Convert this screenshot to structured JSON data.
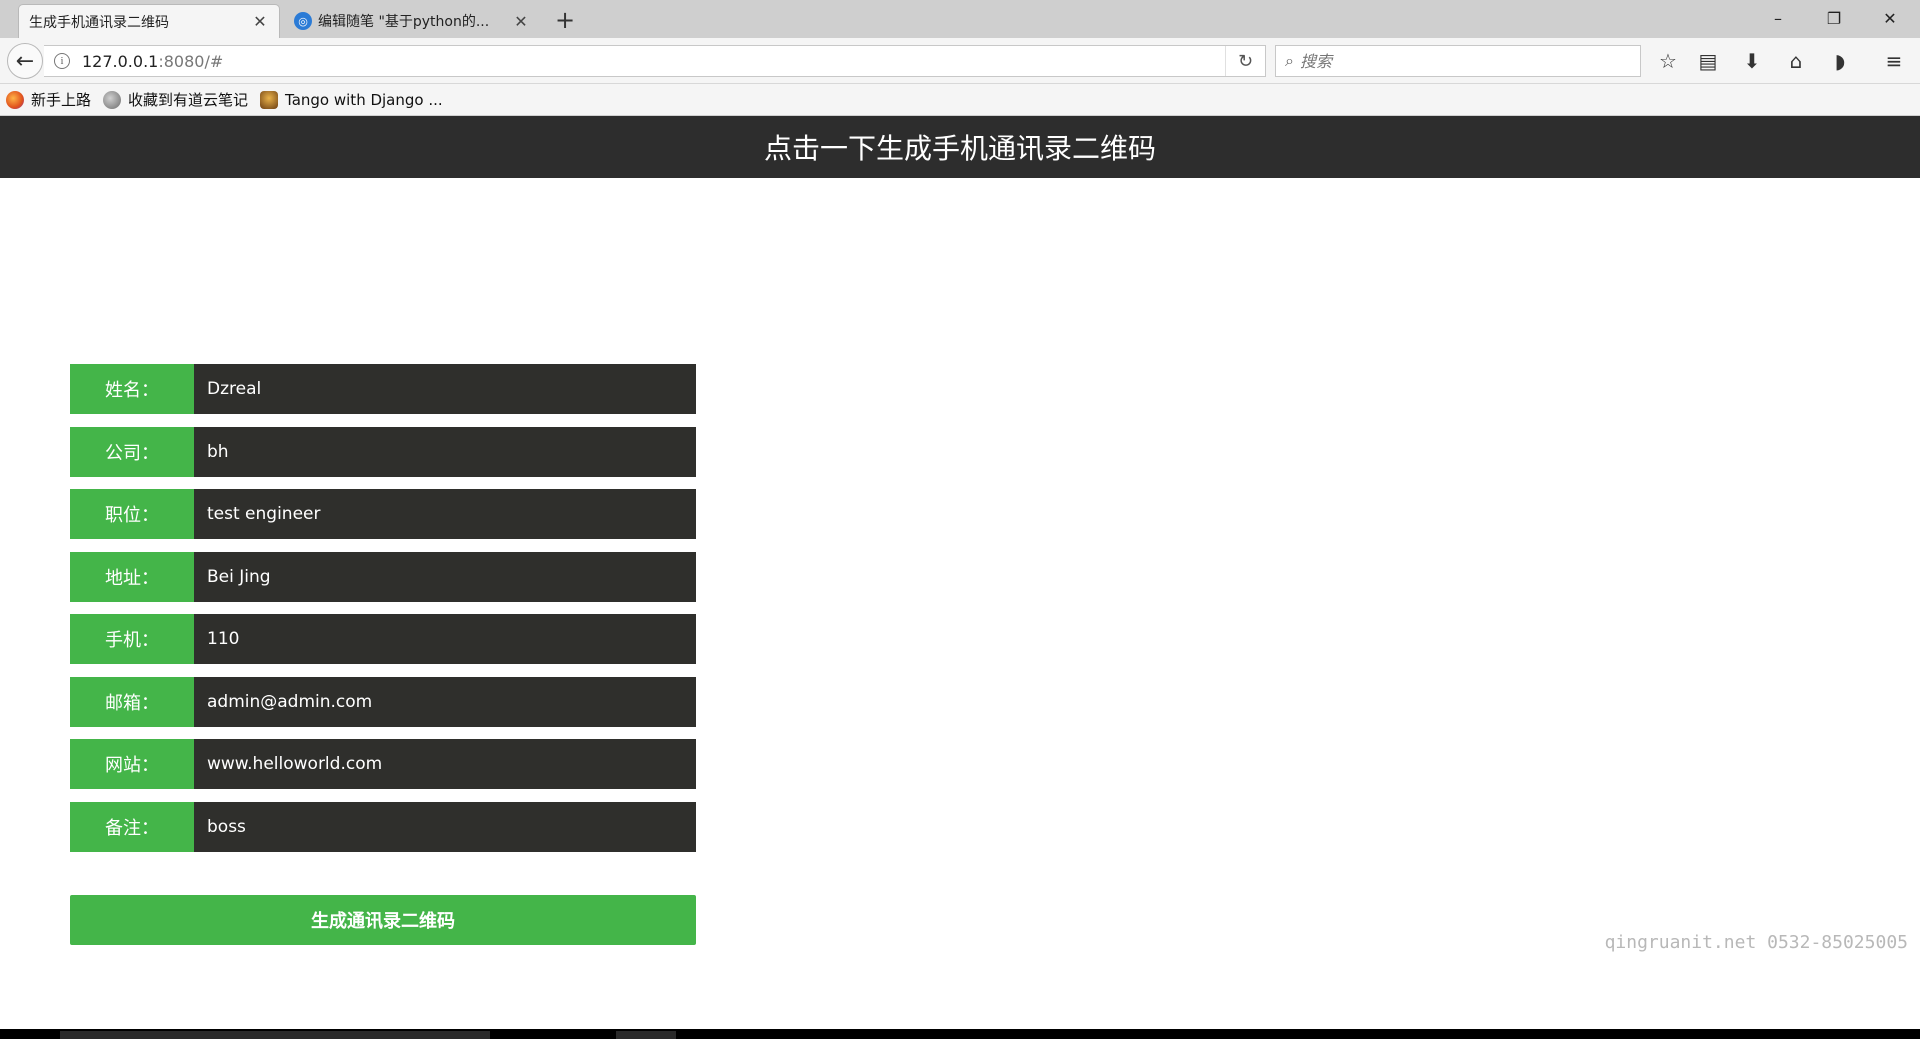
{
  "browser": {
    "tabs": [
      {
        "label": "生成手机通讯录二维码",
        "active": true
      },
      {
        "label": "编辑随笔 \"基于python的...",
        "active": false
      }
    ],
    "new_tab": "+",
    "window_controls": {
      "minimize": "–",
      "restore": "❐",
      "close": "✕"
    },
    "url": {
      "host": "127.0.0.1",
      "rest": ":8080/#"
    },
    "search_placeholder": "搜索",
    "bookmarks": [
      {
        "label": "新手上路",
        "icon": "firefox-icon"
      },
      {
        "label": "收藏到有道云笔记",
        "icon": "globe-icon"
      },
      {
        "label": "Tango with Django ...",
        "icon": "django-icon"
      }
    ],
    "toolbar_icons": [
      "star-icon",
      "library-icon",
      "download-icon",
      "home-icon",
      "pocket-icon",
      "menu-icon"
    ]
  },
  "page": {
    "title": "点击一下生成手机通讯录二维码",
    "fields": [
      {
        "label": "姓名：",
        "value": "Dzreal"
      },
      {
        "label": "公司：",
        "value": "bh"
      },
      {
        "label": "职位：",
        "value": "test engineer"
      },
      {
        "label": "地址：",
        "value": "Bei Jing"
      },
      {
        "label": "手机：",
        "value": "110"
      },
      {
        "label": "邮箱：",
        "value": "admin@admin.com"
      },
      {
        "label": "网站：",
        "value": "www.helloworld.com"
      },
      {
        "label": "备注：",
        "value": "boss"
      }
    ],
    "submit_label": "生成通讯录二维码",
    "watermark": "qingruanit.net 0532-85025005"
  },
  "colors": {
    "header_bg": "#2d2d2d",
    "label_green": "#44b549",
    "value_bg": "#2f2f2c"
  }
}
